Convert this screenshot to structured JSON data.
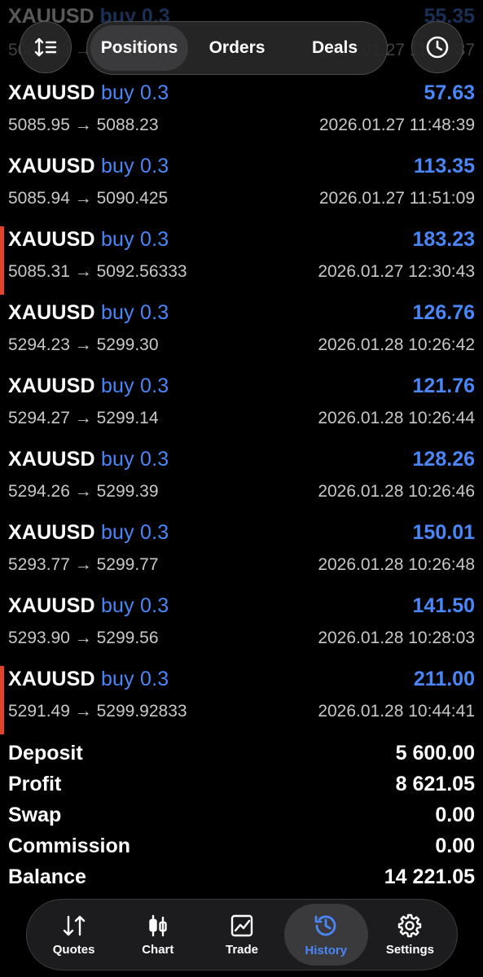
{
  "faded_row": {
    "symbol": "XAUUSD",
    "side": "buy 0.3",
    "profit": "55.35",
    "prices": "5085.93 → 5089.03",
    "time": "2026.01.27 11:48:37"
  },
  "top_tabs": [
    {
      "label": "Positions",
      "active": true
    },
    {
      "label": "Orders",
      "active": false
    },
    {
      "label": "Deals",
      "active": false
    }
  ],
  "deals": [
    {
      "symbol": "XAUUSD",
      "side": "buy 0.3",
      "profit": "57.63",
      "open": "5085.95",
      "close": "5088.23",
      "time": "2026.01.27 11:48:39",
      "marker": false
    },
    {
      "symbol": "XAUUSD",
      "side": "buy 0.3",
      "profit": "113.35",
      "open": "5085.94",
      "close": "5090.425",
      "time": "2026.01.27 11:51:09",
      "marker": false
    },
    {
      "symbol": "XAUUSD",
      "side": "buy 0.3",
      "profit": "183.23",
      "open": "5085.31",
      "close": "5092.56333",
      "time": "2026.01.27 12:30:43",
      "marker": true
    },
    {
      "symbol": "XAUUSD",
      "side": "buy 0.3",
      "profit": "126.76",
      "open": "5294.23",
      "close": "5299.30",
      "time": "2026.01.28 10:26:42",
      "marker": false
    },
    {
      "symbol": "XAUUSD",
      "side": "buy 0.3",
      "profit": "121.76",
      "open": "5294.27",
      "close": "5299.14",
      "time": "2026.01.28 10:26:44",
      "marker": false
    },
    {
      "symbol": "XAUUSD",
      "side": "buy 0.3",
      "profit": "128.26",
      "open": "5294.26",
      "close": "5299.39",
      "time": "2026.01.28 10:26:46",
      "marker": false
    },
    {
      "symbol": "XAUUSD",
      "side": "buy 0.3",
      "profit": "150.01",
      "open": "5293.77",
      "close": "5299.77",
      "time": "2026.01.28 10:26:48",
      "marker": false
    },
    {
      "symbol": "XAUUSD",
      "side": "buy 0.3",
      "profit": "141.50",
      "open": "5293.90",
      "close": "5299.56",
      "time": "2026.01.28 10:28:03",
      "marker": false
    },
    {
      "symbol": "XAUUSD",
      "side": "buy 0.3",
      "profit": "211.00",
      "open": "5291.49",
      "close": "5299.92833",
      "time": "2026.01.28 10:44:41",
      "marker": true
    }
  ],
  "arrow": "→",
  "summary": [
    {
      "label": "Deposit",
      "value": "5 600.00"
    },
    {
      "label": "Profit",
      "value": "8 621.05"
    },
    {
      "label": "Swap",
      "value": "0.00"
    },
    {
      "label": "Commission",
      "value": "0.00"
    },
    {
      "label": "Balance",
      "value": "14 221.05"
    }
  ],
  "bottom_tabs": [
    {
      "label": "Quotes",
      "icon": "quotes-arrows-icon",
      "active": false
    },
    {
      "label": "Chart",
      "icon": "candlestick-icon",
      "active": false
    },
    {
      "label": "Trade",
      "icon": "trade-chart-icon",
      "active": false
    },
    {
      "label": "History",
      "icon": "history-clock-icon",
      "active": true
    },
    {
      "label": "Settings",
      "icon": "gear-icon",
      "active": false
    }
  ],
  "colors": {
    "accent": "#4a86f7",
    "marker": "#e0442f",
    "background": "#000000"
  }
}
